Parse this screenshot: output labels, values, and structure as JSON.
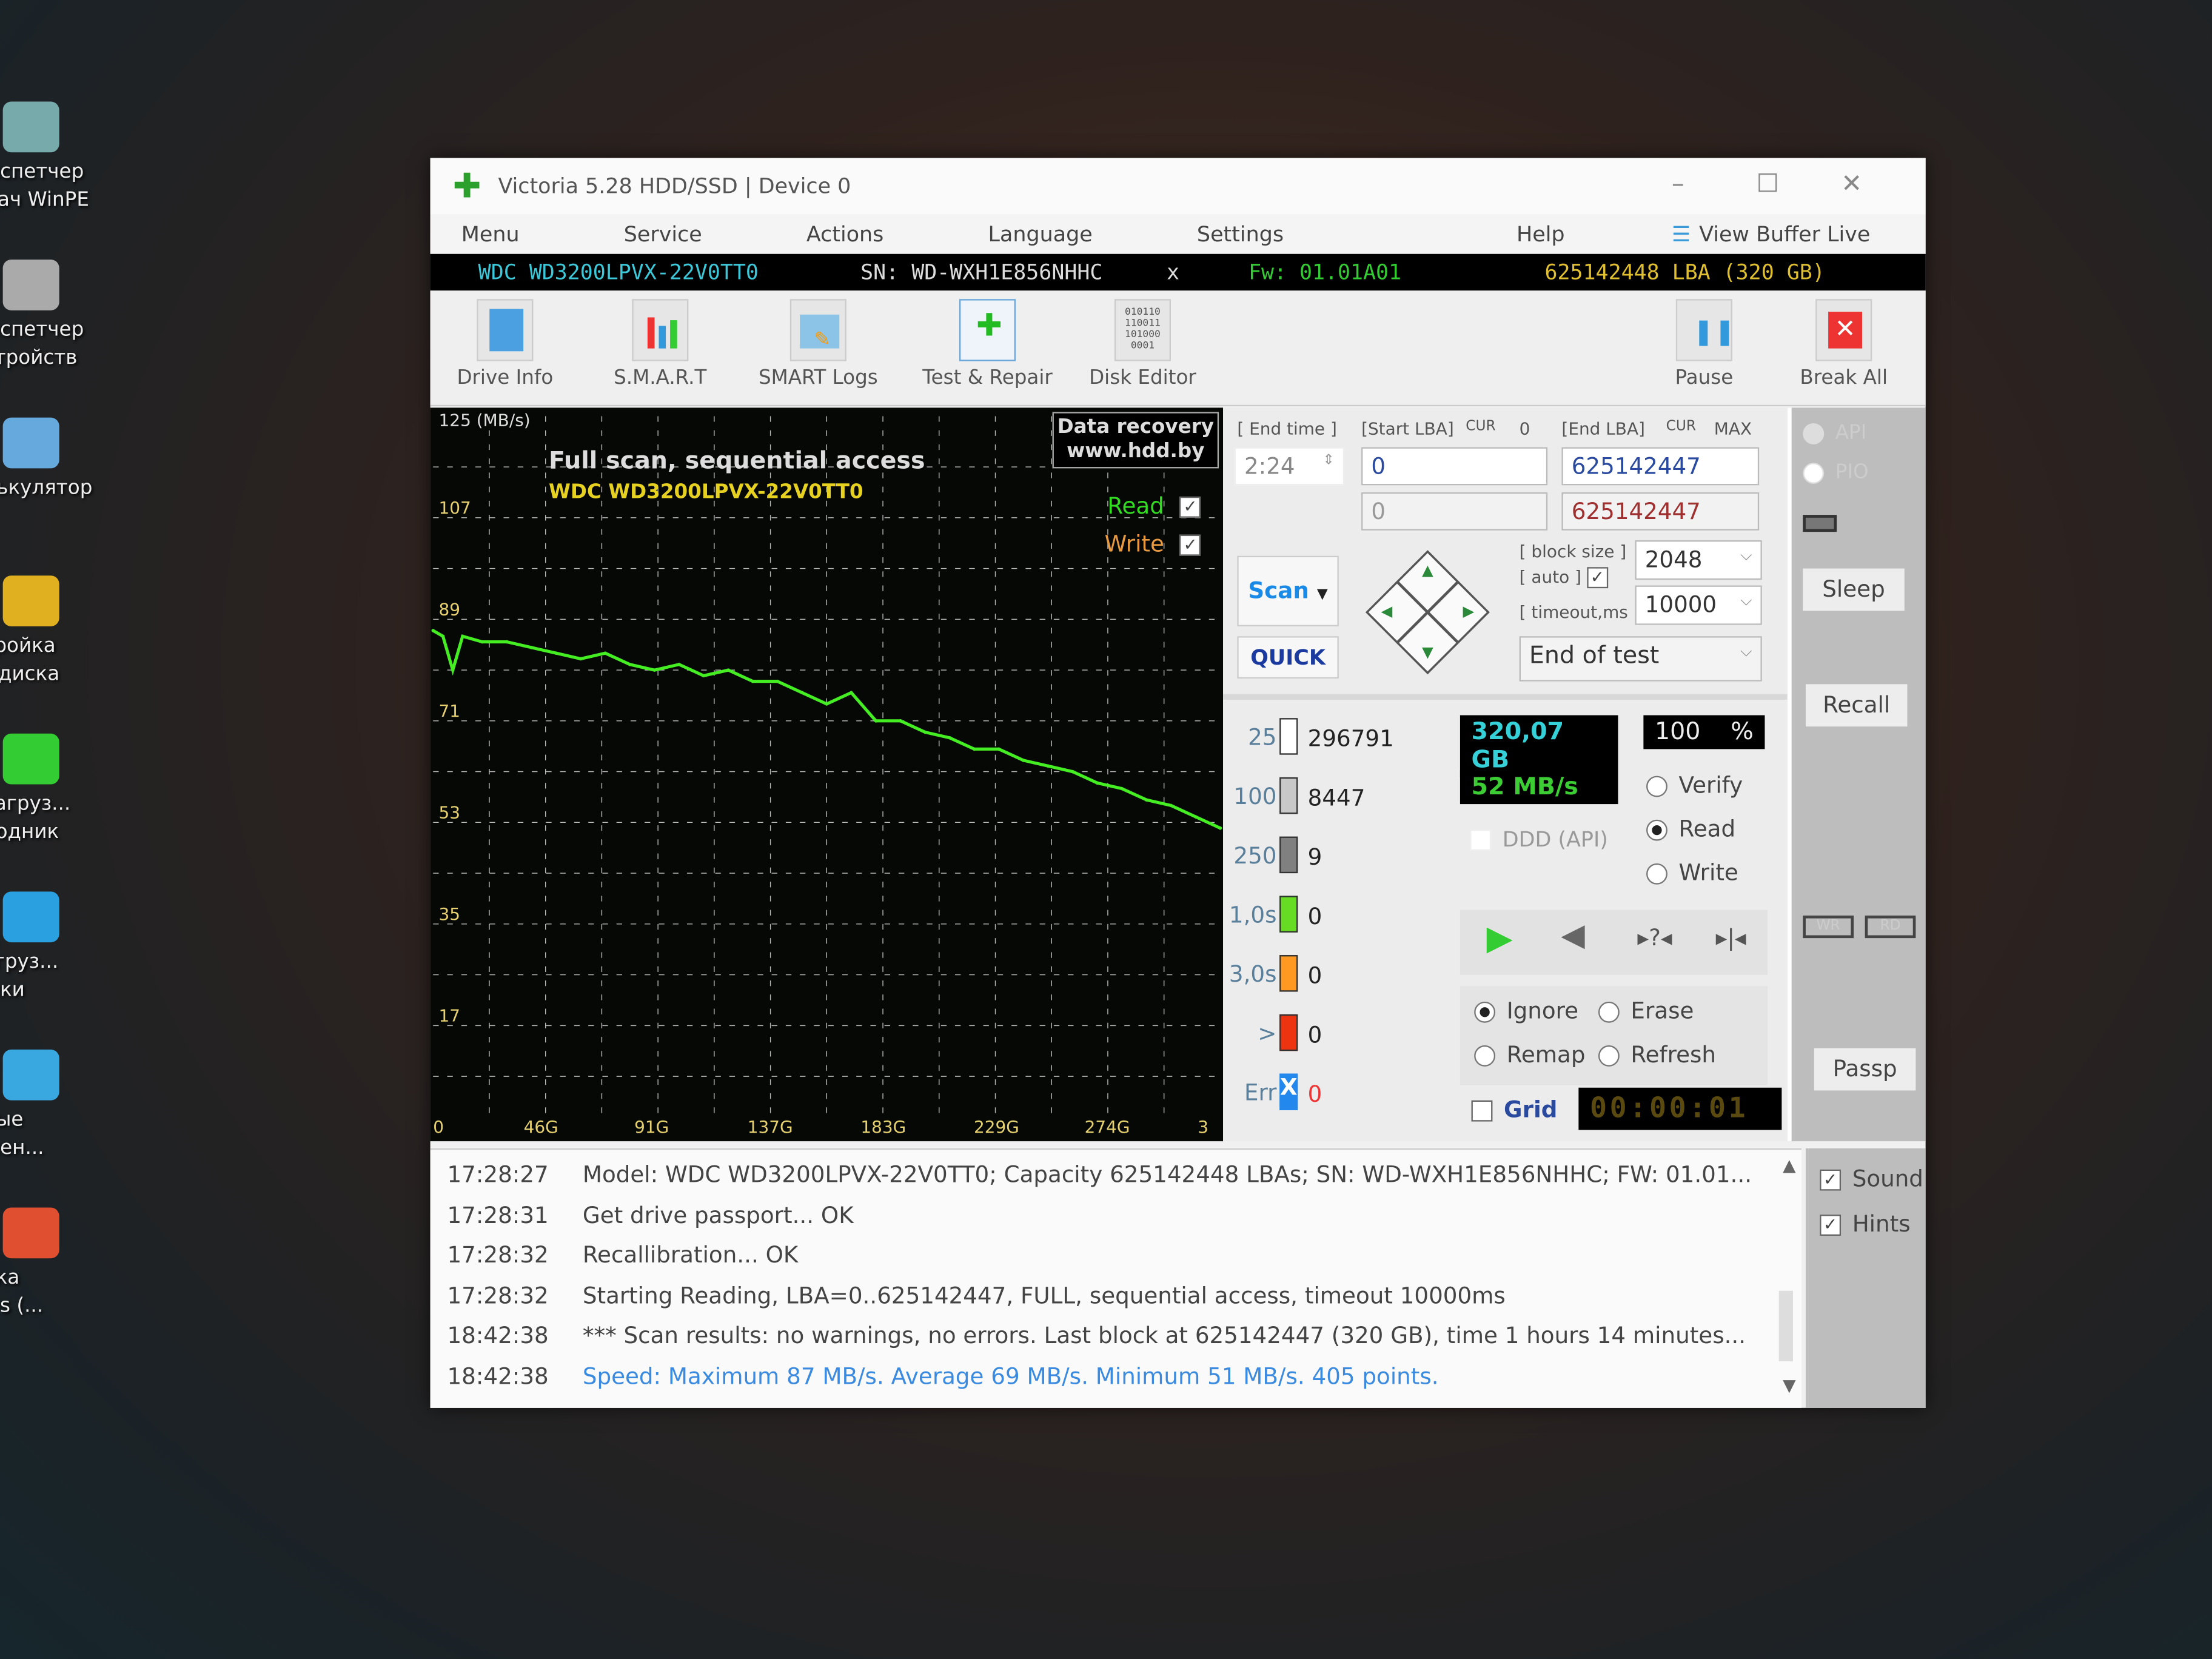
{
  "desktop": {
    "icons": [
      {
        "name": "task-manager",
        "lines": [
          "Диспетчер",
          "адач WinPE"
        ],
        "color": "#7aa"
      },
      {
        "name": "device-manager",
        "lines": [
          "Диспетчер",
          "устройств"
        ],
        "color": "#aaa"
      },
      {
        "name": "calculator",
        "lines": [
          "алькулятор"
        ],
        "color": "#6ad"
      },
      {
        "name": "ramdisk-setup",
        "lines": [
          "стройка",
          "m-диска"
        ],
        "color": "#e0b020"
      },
      {
        "name": "explorer-reload",
        "lines": [
          "езагруз...",
          "оводник"
        ],
        "color": "#3c3"
      },
      {
        "name": "shortcuts-reload",
        "lines": [
          "загруз...",
          "лыки"
        ],
        "color": "#2aa0e0"
      },
      {
        "name": "network",
        "lines": [
          "евые",
          "ючен..."
        ],
        "color": "#3aa8e0"
      },
      {
        "name": "windows-install",
        "lines": [
          "овка",
          "ows (..."
        ],
        "color": "#e05030"
      }
    ]
  },
  "window": {
    "title": "Victoria 5.28 HDD/SSD | Device 0",
    "menu": [
      "Menu",
      "Service",
      "Actions",
      "Language",
      "Settings"
    ],
    "help": "Help",
    "view_buffer": "View Buffer Live",
    "info": {
      "model": "WDC WD3200LPVX-22V0TT0",
      "serial": "SN: WD-WXH1E856NHHC",
      "close": "x",
      "firmware": "Fw: 01.01A01",
      "capacity": "625142448 LBA (320 GB)"
    },
    "toolbar": [
      "Drive Info",
      "S.M.A.R.T",
      "SMART Logs",
      "Test & Repair",
      "Disk Editor"
    ],
    "pause": "Pause",
    "break_all": "Break All"
  },
  "chart_data": {
    "type": "line",
    "title": "Full scan, sequential access",
    "subtitle": "WDC WD3200LPVX-22V0TT0",
    "ylabel": "125 (MB/s)",
    "watermark": [
      "Data recovery",
      "www.hdd.by"
    ],
    "yticks": [
      107,
      89,
      71,
      53,
      35,
      17
    ],
    "ylim": [
      0,
      125
    ],
    "xticks": [
      "0",
      "46G",
      "91G",
      "137G",
      "183G",
      "229G",
      "274G",
      "3"
    ],
    "xtick_values": [
      0,
      46,
      91,
      137,
      183,
      229,
      274,
      320
    ],
    "xlim": [
      0,
      320
    ],
    "grid": true,
    "legend": [
      {
        "name": "Read",
        "color": "#33dd22",
        "checked": true
      },
      {
        "name": "Write",
        "color": "#e89a40",
        "checked": true
      }
    ],
    "series": [
      {
        "name": "Read",
        "color": "#44ee22",
        "x": [
          0,
          4,
          8,
          12,
          20,
          30,
          40,
          50,
          60,
          70,
          80,
          90,
          100,
          110,
          120,
          130,
          140,
          150,
          160,
          170,
          180,
          190,
          200,
          210,
          220,
          230,
          240,
          250,
          260,
          270,
          280,
          290,
          300,
          310,
          320
        ],
        "y": [
          87,
          86,
          80,
          86,
          85,
          85,
          84,
          83,
          82,
          83,
          81,
          80,
          81,
          79,
          80,
          78,
          78,
          76,
          74,
          76,
          71,
          71,
          69,
          68,
          66,
          66,
          64,
          63,
          62,
          60,
          59,
          57,
          56,
          54,
          52
        ]
      }
    ]
  },
  "controls": {
    "end_time_label": "[ End time ]",
    "end_time": "2:24",
    "start_lba_label": "[Start LBA]",
    "cur": "CUR",
    "zero": "0",
    "end_lba_label": "[End LBA]",
    "max": "MAX",
    "start_lba": "0",
    "end_lba": "625142447",
    "start_lba_cur": "0",
    "end_lba_cur": "625142447",
    "scan": "Scan",
    "quick": "QUICK",
    "block_size_label": "[ block size ]",
    "auto_label": "[ auto ]",
    "auto_checked": true,
    "block_size": "2048",
    "timeout_label": "[ timeout,ms ]",
    "timeout": "10000",
    "end_action": "End of test",
    "stats": [
      {
        "label": "25",
        "value": "296791",
        "color": "#ffffff"
      },
      {
        "label": "100",
        "value": "8447",
        "color": "#c8c8c8"
      },
      {
        "label": "250",
        "value": "9",
        "color": "#808080"
      },
      {
        "label": "1,0s",
        "value": "0",
        "color": "#66dd22"
      },
      {
        "label": "3,0s",
        "value": "0",
        "color": "#ff9922"
      },
      {
        "label": ">",
        "value": "0",
        "color": "#ee3311"
      },
      {
        "label": "Err",
        "value": "0",
        "color": "#2288ee"
      }
    ],
    "err_mark": "X",
    "size_done": "320,07 GB",
    "percent": "100",
    "percent_sign": "%",
    "progress_percent": 100,
    "speed": "52 MB/s",
    "ddd": "DDD (API)",
    "modes": [
      {
        "label": "Verify",
        "selected": false
      },
      {
        "label": "Read",
        "selected": true
      },
      {
        "label": "Write",
        "selected": false
      }
    ],
    "actions": [
      {
        "label": "Ignore",
        "selected": true
      },
      {
        "label": "Erase",
        "selected": false
      },
      {
        "label": "Remap",
        "selected": false
      },
      {
        "label": "Refresh",
        "selected": false
      }
    ],
    "grid": "Grid",
    "timer": "00:00:01"
  },
  "right": {
    "api": "API",
    "pio": "PIO",
    "sleep": "Sleep",
    "recall": "Recall",
    "wr": "WR",
    "rd": "RD",
    "passp": "Passp",
    "sound": "Sound",
    "hints": "Hints"
  },
  "log": [
    {
      "time": "17:28:27",
      "text": "Model: WDC WD3200LPVX-22V0TT0; Capacity 625142448 LBAs; SN: WD-WXH1E856NHHC; FW: 01.01..."
    },
    {
      "time": "17:28:31",
      "text": "Get drive passport... OK"
    },
    {
      "time": "17:28:32",
      "text": "Recallibration... OK"
    },
    {
      "time": "17:28:32",
      "text": "Starting Reading, LBA=0..625142447, FULL, sequential access, timeout 10000ms"
    },
    {
      "time": "18:42:38",
      "text": "*** Scan results: no warnings, no errors. Last block at 625142447 (320 GB), time 1 hours 14 minutes..."
    },
    {
      "time": "18:42:38",
      "text": "Speed: Maximum 87 MB/s. Average 69 MB/s. Minimum 51 MB/s. 405 points.",
      "highlight": true
    }
  ]
}
